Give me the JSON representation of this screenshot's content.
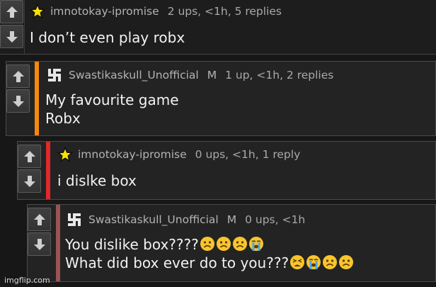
{
  "comments": [
    {
      "author": "imnotokay-ipromise",
      "flair": "",
      "stats": "2 ups, <1h, 5 replies",
      "line1": "I don’t even play robx",
      "line2": "",
      "avatar": "star-icon",
      "accent_color": ""
    },
    {
      "author": "Swastikaskull_Unofficial",
      "flair": "M",
      "stats": "1 up, <1h, 2 replies",
      "line1": "My favourite game",
      "line2": "Robx",
      "avatar": "swastika-icon",
      "accent_color": "#f5890f"
    },
    {
      "author": "imnotokay-ipromise",
      "flair": "",
      "stats": "0 ups, <1h, 1 reply",
      "line1": "i dislke box",
      "line2": "",
      "avatar": "star-icon",
      "accent_color": "#e0282d"
    },
    {
      "author": "Swastikaskull_Unofficial",
      "flair": "M",
      "stats": "0 ups, <1h",
      "line1": "You dislike box????",
      "line2": "What did box ever do to you???",
      "line1_emojis": [
        "slightly-frowning-emoji",
        "slightly-frowning-emoji",
        "slightly-frowning-emoji",
        "loudly-crying-emoji"
      ],
      "line2_emojis": [
        "tired-face-emoji",
        "loudly-crying-emoji",
        "slightly-frowning-emoji",
        "slightly-frowning-emoji"
      ],
      "avatar": "swastika-icon",
      "accent_color": "#9b5252"
    }
  ],
  "watermark": "imgflip.com",
  "colors": {
    "background": "#171717",
    "panel": "#232323",
    "text": "#f2f2f2",
    "meta": "#a9a9a9",
    "star": "#f7e300"
  }
}
